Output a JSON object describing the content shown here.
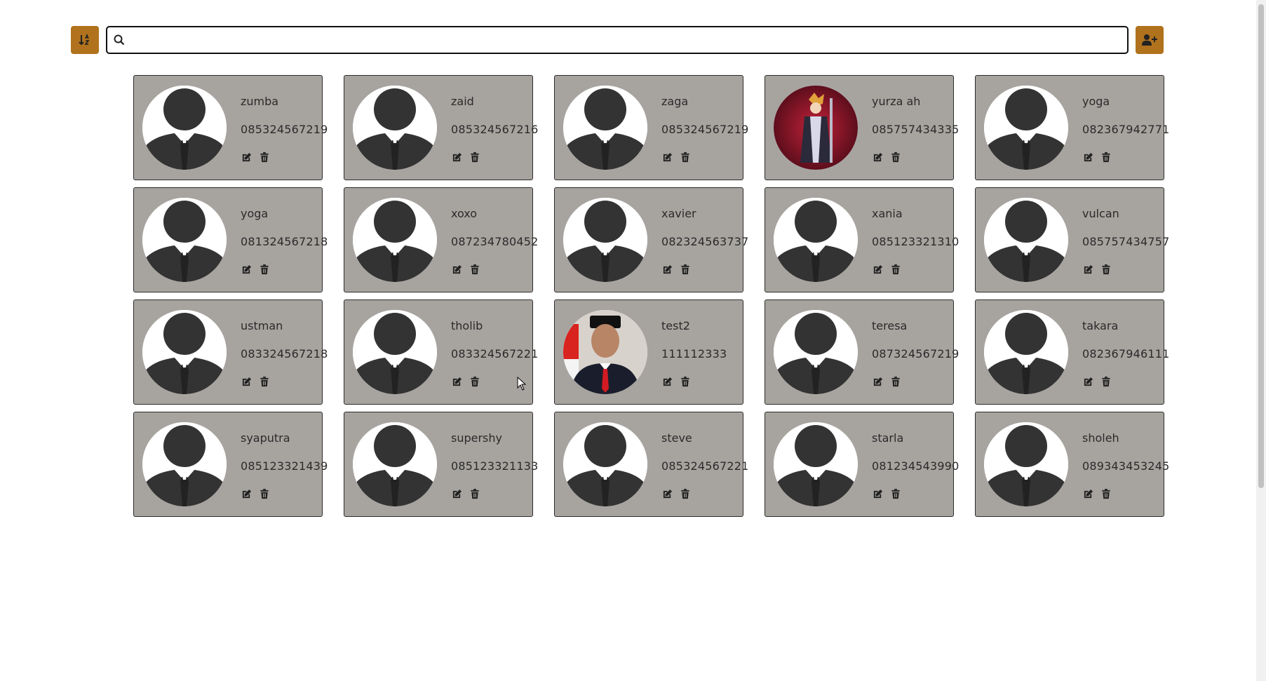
{
  "toolbar": {
    "sort_icon": "sort-alpha-icon",
    "search_icon": "search-icon",
    "search_value": "",
    "add_icon": "add-user-icon",
    "accent": "#b0721c"
  },
  "card_style": {
    "background": "#a7a4a0",
    "border": "#2b2b2b"
  },
  "contacts": [
    {
      "name": "zumba",
      "phone": "085324567219",
      "avatar": "default"
    },
    {
      "name": "zaid",
      "phone": "085324567216",
      "avatar": "default"
    },
    {
      "name": "zaga",
      "phone": "085324567219",
      "avatar": "default"
    },
    {
      "name": "yurza ah",
      "phone": "085757434335",
      "avatar": "photo-anime"
    },
    {
      "name": "yoga",
      "phone": "082367942771",
      "avatar": "default"
    },
    {
      "name": "yoga",
      "phone": "081324567218",
      "avatar": "default"
    },
    {
      "name": "xoxo",
      "phone": "087234780452",
      "avatar": "default"
    },
    {
      "name": "xavier",
      "phone": "082324563737",
      "avatar": "default"
    },
    {
      "name": "xania",
      "phone": "085123321310",
      "avatar": "default"
    },
    {
      "name": "vulcan",
      "phone": "085757434757",
      "avatar": "default"
    },
    {
      "name": "ustman",
      "phone": "083324567218",
      "avatar": "default"
    },
    {
      "name": "tholib",
      "phone": "083324567221",
      "avatar": "default"
    },
    {
      "name": "test2",
      "phone": "111112333",
      "avatar": "photo-portrait"
    },
    {
      "name": "teresa",
      "phone": "087324567219",
      "avatar": "default"
    },
    {
      "name": "takara",
      "phone": "082367946111",
      "avatar": "default"
    },
    {
      "name": "syaputra",
      "phone": "085123321439",
      "avatar": "default"
    },
    {
      "name": "supershy",
      "phone": "085123321133",
      "avatar": "default"
    },
    {
      "name": "steve",
      "phone": "085324567221",
      "avatar": "default"
    },
    {
      "name": "starla",
      "phone": "081234543990",
      "avatar": "default"
    },
    {
      "name": "sholeh",
      "phone": "089343453245",
      "avatar": "default"
    }
  ],
  "card_actions": {
    "edit_icon": "edit-icon",
    "delete_icon": "trash-icon"
  }
}
